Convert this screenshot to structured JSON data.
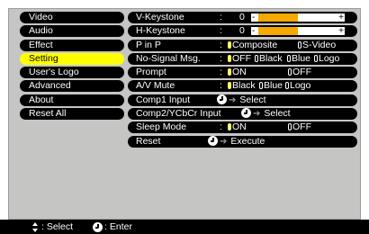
{
  "menu": {
    "items": [
      {
        "label": "Video"
      },
      {
        "label": "Audio"
      },
      {
        "label": "Effect"
      },
      {
        "label": "Setting",
        "selected": true
      },
      {
        "label": "User's Logo"
      },
      {
        "label": "Advanced"
      },
      {
        "label": "About"
      },
      {
        "label": "Reset All"
      }
    ]
  },
  "settings": {
    "v_keystone": {
      "label": "V-Keystone",
      "colon": ":",
      "value": "0",
      "minus": "-",
      "plus": "+",
      "level_fraction": 0.5
    },
    "h_keystone": {
      "label": "H-Keystone",
      "colon": ":",
      "value": "0",
      "minus": "-",
      "plus": "+",
      "level_fraction": 0.5
    },
    "p_in_p": {
      "label": "P in P",
      "colon": ":",
      "options": [
        "Composite",
        "S-Video"
      ],
      "selected": "Composite"
    },
    "no_signal": {
      "label": "No-Signal Msg.",
      "colon": ":",
      "options": [
        "OFF",
        "Black",
        "Blue",
        "Logo"
      ],
      "selected": "OFF"
    },
    "prompt": {
      "label": "Prompt",
      "colon": ":",
      "options": [
        "ON",
        "OFF"
      ],
      "selected": "ON"
    },
    "av_mute": {
      "label": "A/V Mute",
      "colon": ":",
      "options": [
        "Black",
        "Blue",
        "Logo"
      ],
      "selected": "Black"
    },
    "comp1_input": {
      "label": "Comp1 Input",
      "action": "Select"
    },
    "comp2_input": {
      "label": "Comp2/YCbCr Input",
      "action": "Select"
    },
    "sleep_mode": {
      "label": "Sleep Mode",
      "colon": ":",
      "options": [
        "ON",
        "OFF"
      ],
      "selected": "ON"
    },
    "reset": {
      "label": "Reset",
      "action": "Execute"
    }
  },
  "footer": {
    "select_label": ": Select",
    "enter_label": ": Enter"
  },
  "colors": {
    "panel": "#c5c6c4",
    "row": "#000000",
    "highlight": "#ffff00",
    "bar_fill": "#f5a800",
    "footer": "#000000"
  }
}
